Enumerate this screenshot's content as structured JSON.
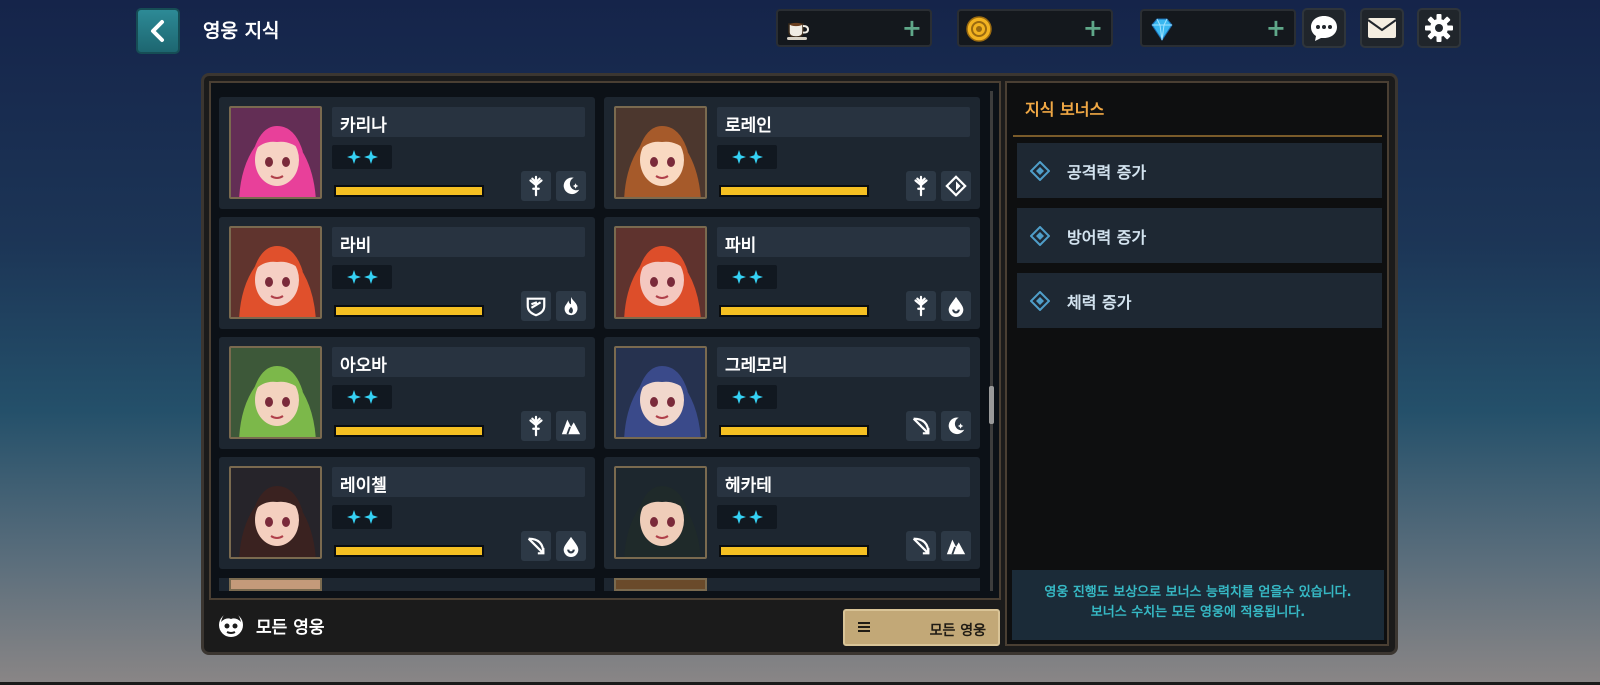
{
  "header": {
    "title": "영웅 지식",
    "currencies": [
      {
        "icon": "coffee-cup-icon",
        "plus": "+"
      },
      {
        "icon": "gold-coin-icon",
        "plus": "+"
      },
      {
        "icon": "diamond-gem-icon",
        "plus": "+"
      }
    ]
  },
  "heroes": [
    {
      "name": "카리나",
      "stars": "✦✦",
      "xp": 1.0,
      "class_icon": "sword-class-icon",
      "element_icon": "moon-element-icon",
      "hair": "#e8409a",
      "skin": "#f6d3c4"
    },
    {
      "name": "로레인",
      "stars": "✦✦",
      "xp": 1.0,
      "class_icon": "sword-class-icon",
      "element_icon": "rune-element-icon",
      "hair": "#a65a2a",
      "skin": "#f9d9c1"
    },
    {
      "name": "라비",
      "stars": "✦✦",
      "xp": 1.0,
      "class_icon": "shield-class-icon",
      "element_icon": "fire-element-icon",
      "hair": "#e0502c",
      "skin": "#f5cfc4"
    },
    {
      "name": "파비",
      "stars": "✦✦",
      "xp": 1.0,
      "class_icon": "sword-class-icon",
      "element_icon": "water-element-icon",
      "hair": "#dd4e2a",
      "skin": "#f4c8c0"
    },
    {
      "name": "아오바",
      "stars": "✦✦",
      "xp": 1.0,
      "class_icon": "sword-class-icon",
      "element_icon": "earth-element-icon",
      "hair": "#7cb84a",
      "skin": "#f3d3bf"
    },
    {
      "name": "그레모리",
      "stars": "✦✦",
      "xp": 1.0,
      "class_icon": "bow-class-icon",
      "element_icon": "moon-element-icon",
      "hair": "#3a4a8a",
      "skin": "#f1d7cc"
    },
    {
      "name": "레이첼",
      "stars": "✦✦",
      "xp": 1.0,
      "class_icon": "bow-class-icon",
      "element_icon": "water-element-icon",
      "hair": "#3a2220",
      "skin": "#f4cfbf"
    },
    {
      "name": "헤카테",
      "stars": "✦✦",
      "xp": 1.0,
      "class_icon": "bow-class-icon",
      "element_icon": "earth-element-icon",
      "hair": "#1f2a2a",
      "skin": "#efcdb9"
    }
  ],
  "footer": {
    "label": "모든 영웅",
    "filter_label": "모든 영웅"
  },
  "bonus": {
    "title": "지식 보너스",
    "items": [
      "공격력 증가",
      "방어력 증가",
      "체력 증가"
    ],
    "note_line1": "영웅 진행도 보상으로 보너스 능력치를 얻을수 있습니다.",
    "note_line2": "보너스 수치는 모든 영웅에 적용됩니다."
  },
  "colors": {
    "accent_gold": "#f0a845",
    "xp_bar": "#f5c022",
    "star": "#35d2f5",
    "note_text": "#36b8c4"
  }
}
